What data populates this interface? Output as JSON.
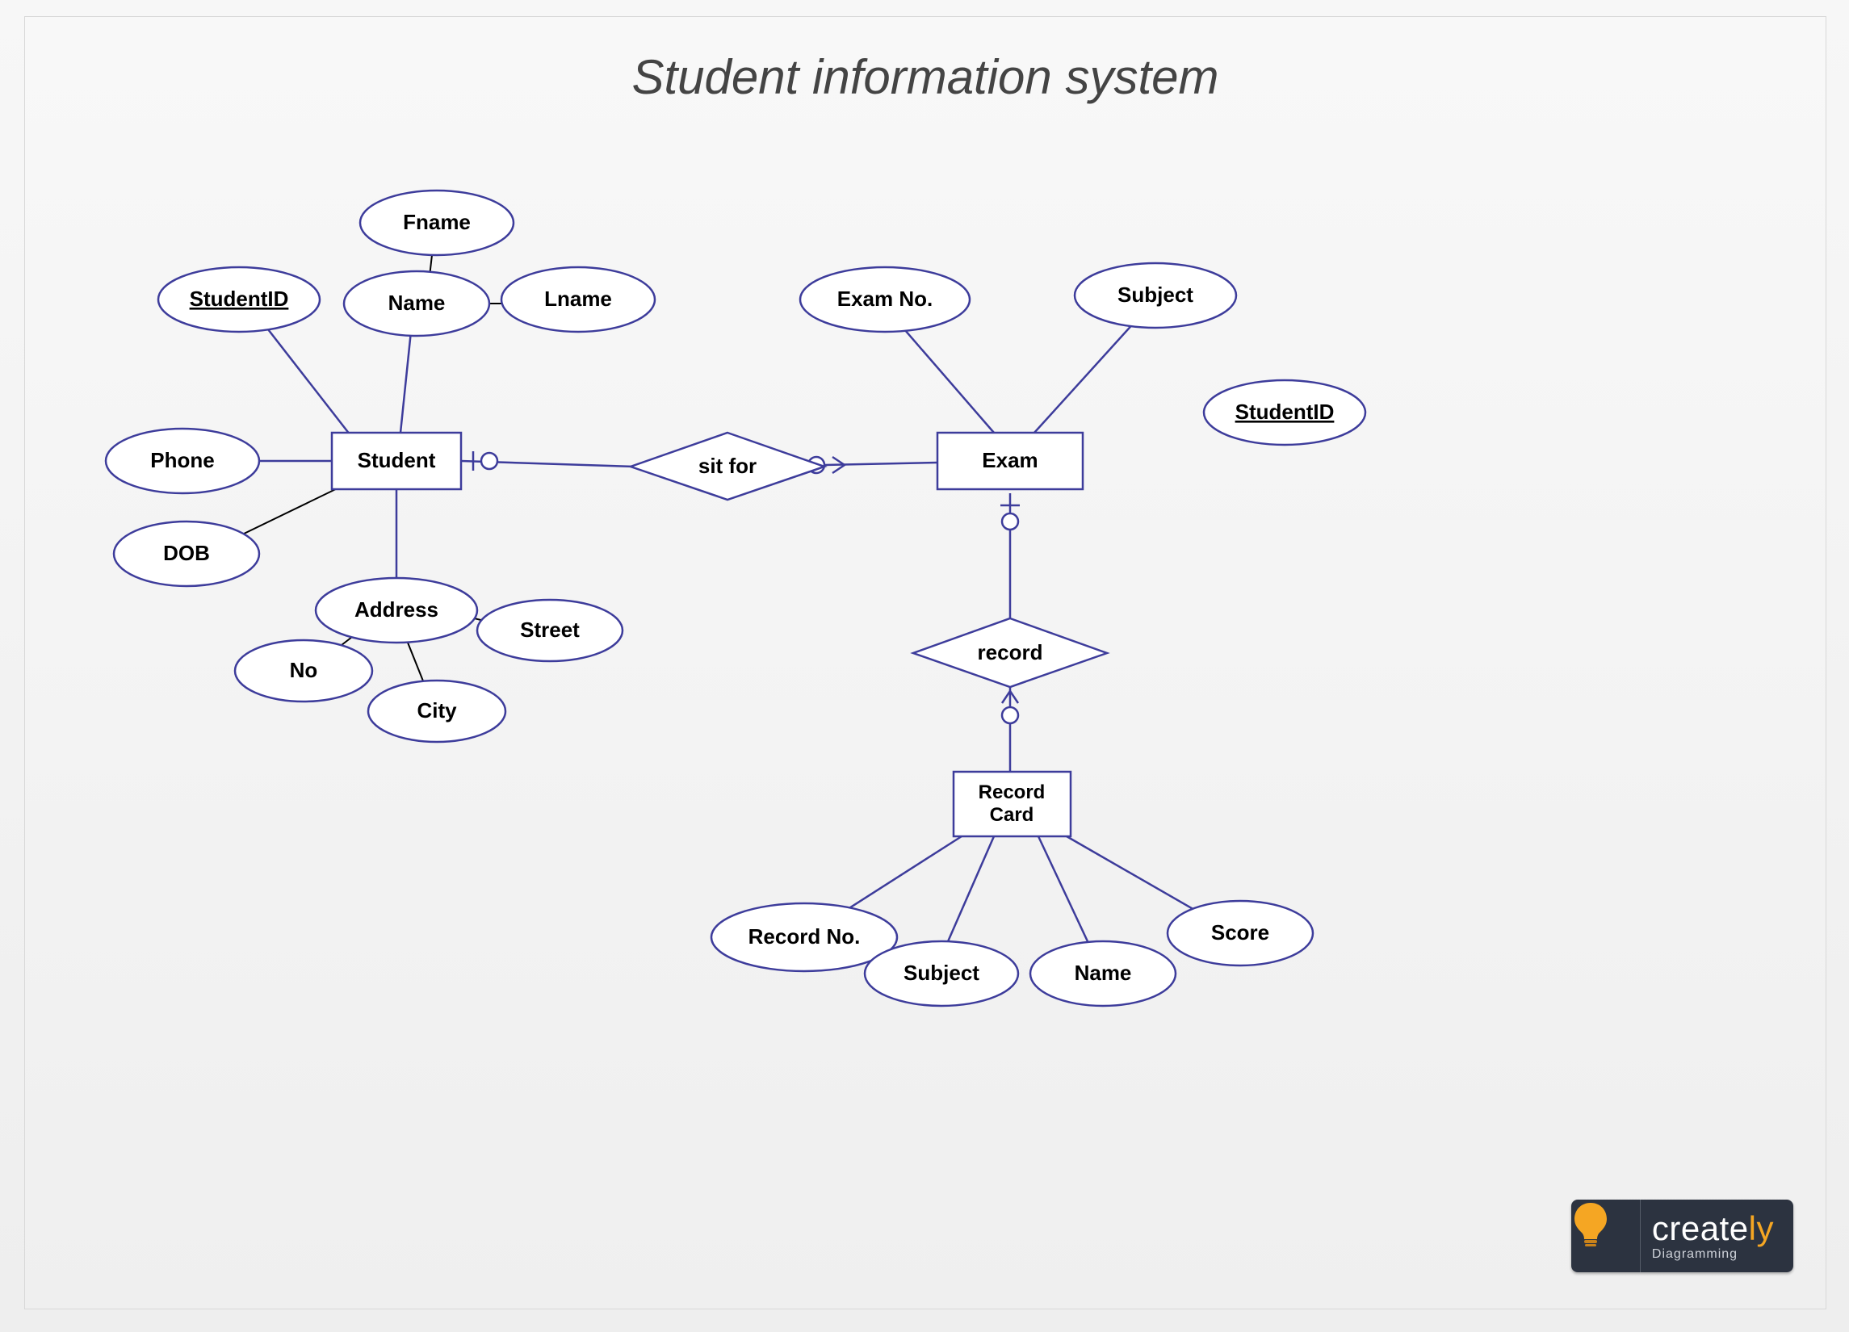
{
  "title": "Student information system",
  "entities": {
    "student": "Student",
    "exam": "Exam",
    "record_card": "Record Card"
  },
  "relationships": {
    "sit_for": "sit for",
    "record": "record"
  },
  "attributes": {
    "student_id": "StudentID",
    "phone": "Phone",
    "dob": "DOB",
    "name": "Name",
    "fname": "Fname",
    "lname": "Lname",
    "address": "Address",
    "no": "No",
    "city": "City",
    "street": "Street",
    "exam_no": "Exam No.",
    "subject_exam": "Subject",
    "student_id_exam": "StudentID",
    "record_no": "Record No.",
    "subject_rc": "Subject",
    "name_rc": "Name",
    "score": "Score"
  },
  "logo": {
    "brand_prefix": "create",
    "brand_suffix": "ly",
    "tagline": "Diagramming"
  }
}
